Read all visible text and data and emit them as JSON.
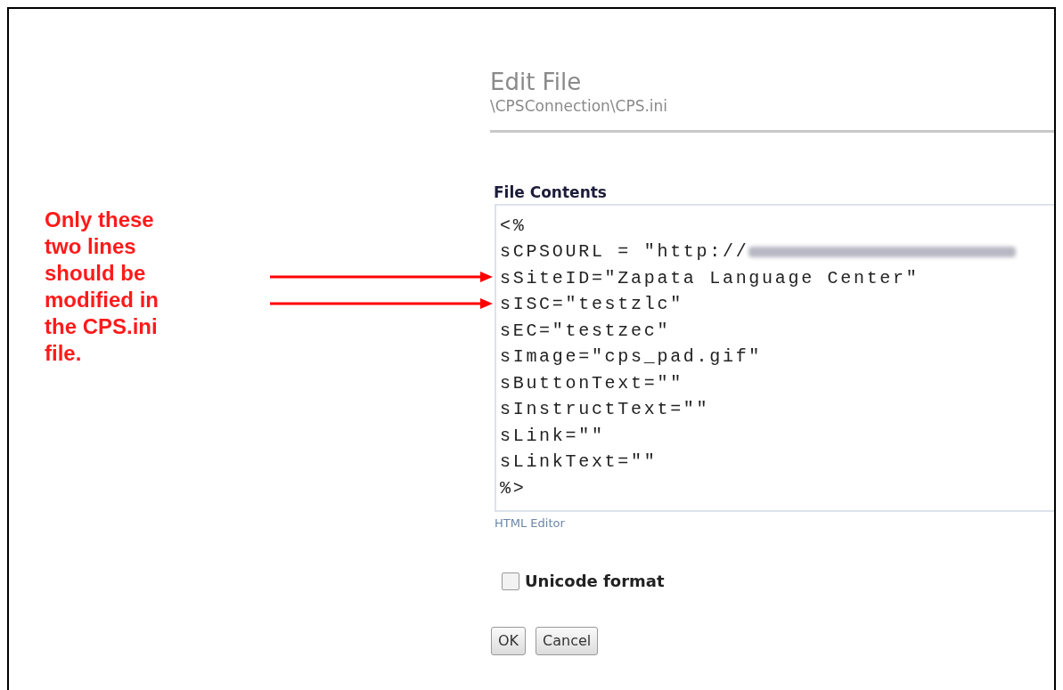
{
  "annotation": {
    "text": "Only these two lines should be modified in the CPS.ini file."
  },
  "page": {
    "title": "Edit File",
    "path": "\\CPSConnection\\CPS.ini"
  },
  "file_contents": {
    "label": "File Contents",
    "lines": [
      {
        "text": "<%",
        "marked": false,
        "blurred": false
      },
      {
        "text": "sCPSOURL = \"http://",
        "marked": false,
        "blurred": true
      },
      {
        "text": "sSiteID=\"Zapata Language Center\"",
        "marked": true,
        "blurred": false
      },
      {
        "text": "sISC=\"testzlc\"",
        "marked": true,
        "blurred": false
      },
      {
        "text": "sEC=\"testzec\"",
        "marked": false,
        "blurred": false
      },
      {
        "text": "sImage=\"cps_pad.gif\"",
        "marked": false,
        "blurred": false
      },
      {
        "text": "sButtonText=\"\"",
        "marked": false,
        "blurred": false
      },
      {
        "text": "sInstructText=\"\"",
        "marked": false,
        "blurred": false
      },
      {
        "text": "sLink=\"\"",
        "marked": false,
        "blurred": false
      },
      {
        "text": "sLinkText=\"\"",
        "marked": false,
        "blurred": false
      },
      {
        "text": "%>",
        "marked": false,
        "blurred": false
      }
    ]
  },
  "editor_link": "HTML Editor",
  "unicode": {
    "label": "Unicode format",
    "checked": false
  },
  "buttons": [
    "OK",
    "Cancel"
  ]
}
